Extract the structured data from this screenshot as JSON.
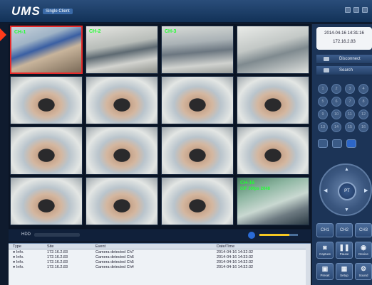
{
  "app": {
    "name": "UMS",
    "subtitle": "Single Client"
  },
  "cameras": [
    {
      "label": "CH-1",
      "sub": "",
      "scene": "desk"
    },
    {
      "label": "CH-2",
      "sub": "",
      "scene": "office"
    },
    {
      "label": "CH-3",
      "sub": "",
      "scene": "office2"
    },
    {
      "label": "",
      "sub": "",
      "scene": "office3"
    },
    {
      "label": "",
      "sub": "",
      "scene": "face"
    },
    {
      "label": "",
      "sub": "",
      "scene": "face"
    },
    {
      "label": "",
      "sub": "",
      "scene": "face"
    },
    {
      "label": "",
      "sub": "",
      "scene": "face"
    },
    {
      "label": "",
      "sub": "",
      "scene": "face"
    },
    {
      "label": "",
      "sub": "",
      "scene": "face"
    },
    {
      "label": "",
      "sub": "",
      "scene": "face"
    },
    {
      "label": "",
      "sub": "",
      "scene": "face"
    },
    {
      "label": "",
      "sub": "",
      "scene": "face"
    },
    {
      "label": "",
      "sub": "",
      "scene": "face"
    },
    {
      "label": "",
      "sub": "",
      "scene": "face"
    },
    {
      "label": "CH-16",
      "sub": "CIF 30fps 2048",
      "scene": "person"
    }
  ],
  "playbar": {
    "hdd_label": "HDD",
    "volume_level": 0.78
  },
  "log": {
    "headers": [
      "Type",
      "Site",
      "Event",
      "Date/Time"
    ],
    "rows": [
      [
        "Info.",
        "172.16.2.83",
        "Camera detected Ch7",
        "2014-04-16 14:32:32"
      ],
      [
        "Info.",
        "172.16.2.83",
        "Camera detected Ch6",
        "2014-04-16 14:33:32"
      ],
      [
        "Info.",
        "172.16.2.83",
        "Camera detected Ch5",
        "2014-04-16 14:32:32"
      ],
      [
        "Info.",
        "172.16.2.83",
        "Camera detected Ch4",
        "2014-04-16 14:32:32"
      ]
    ]
  },
  "panel": {
    "datetime": "2014-04-16 14:31:16",
    "ip": "172.16.2.83",
    "disconnect": "Disconnect",
    "search": "Search",
    "numbers": [
      "1",
      "2",
      "3",
      "4",
      "5",
      "6",
      "7",
      "8",
      "9",
      "10",
      "11",
      "12",
      "13",
      "14",
      "15",
      "16"
    ],
    "ptz_center": "PT",
    "ctl_buttons": [
      "CH1",
      "CH2",
      "CH3"
    ],
    "actions_top": [
      {
        "glyph": "◙",
        "label": "Capture"
      },
      {
        "glyph": "❚❚",
        "label": "Pause"
      },
      {
        "glyph": "◉",
        "label": "Device"
      }
    ],
    "actions_bottom": [
      {
        "glyph": "▣",
        "label": "Preset"
      },
      {
        "glyph": "▦",
        "label": "Setup"
      },
      {
        "glyph": "⚙",
        "label": "Sound"
      }
    ]
  }
}
